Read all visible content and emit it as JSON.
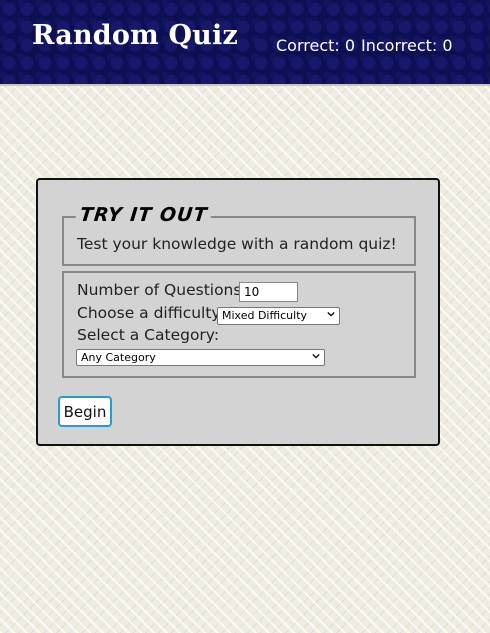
{
  "header": {
    "title": "Random Quiz",
    "correct_label": "Correct: 0",
    "incorrect_label": "Incorrect: 0"
  },
  "card": {
    "legend": "TRY IT OUT",
    "intro": "Test your knowledge with a random quiz!",
    "questions_label": "Number of Questions",
    "questions_value": "10",
    "difficulty_label": "Choose a difficulty",
    "difficulty_selected": "Mixed Difficulty",
    "category_label": "Select a Category:",
    "category_selected": "Any Category",
    "begin_label": "Begin"
  },
  "colors": {
    "header_bg": "#0e0f52",
    "page_bg": "#efece1",
    "card_bg": "#d3d3d3",
    "button_border": "#2a9bd0"
  },
  "icons": {
    "select_arrow": "chevron-down-icon"
  }
}
